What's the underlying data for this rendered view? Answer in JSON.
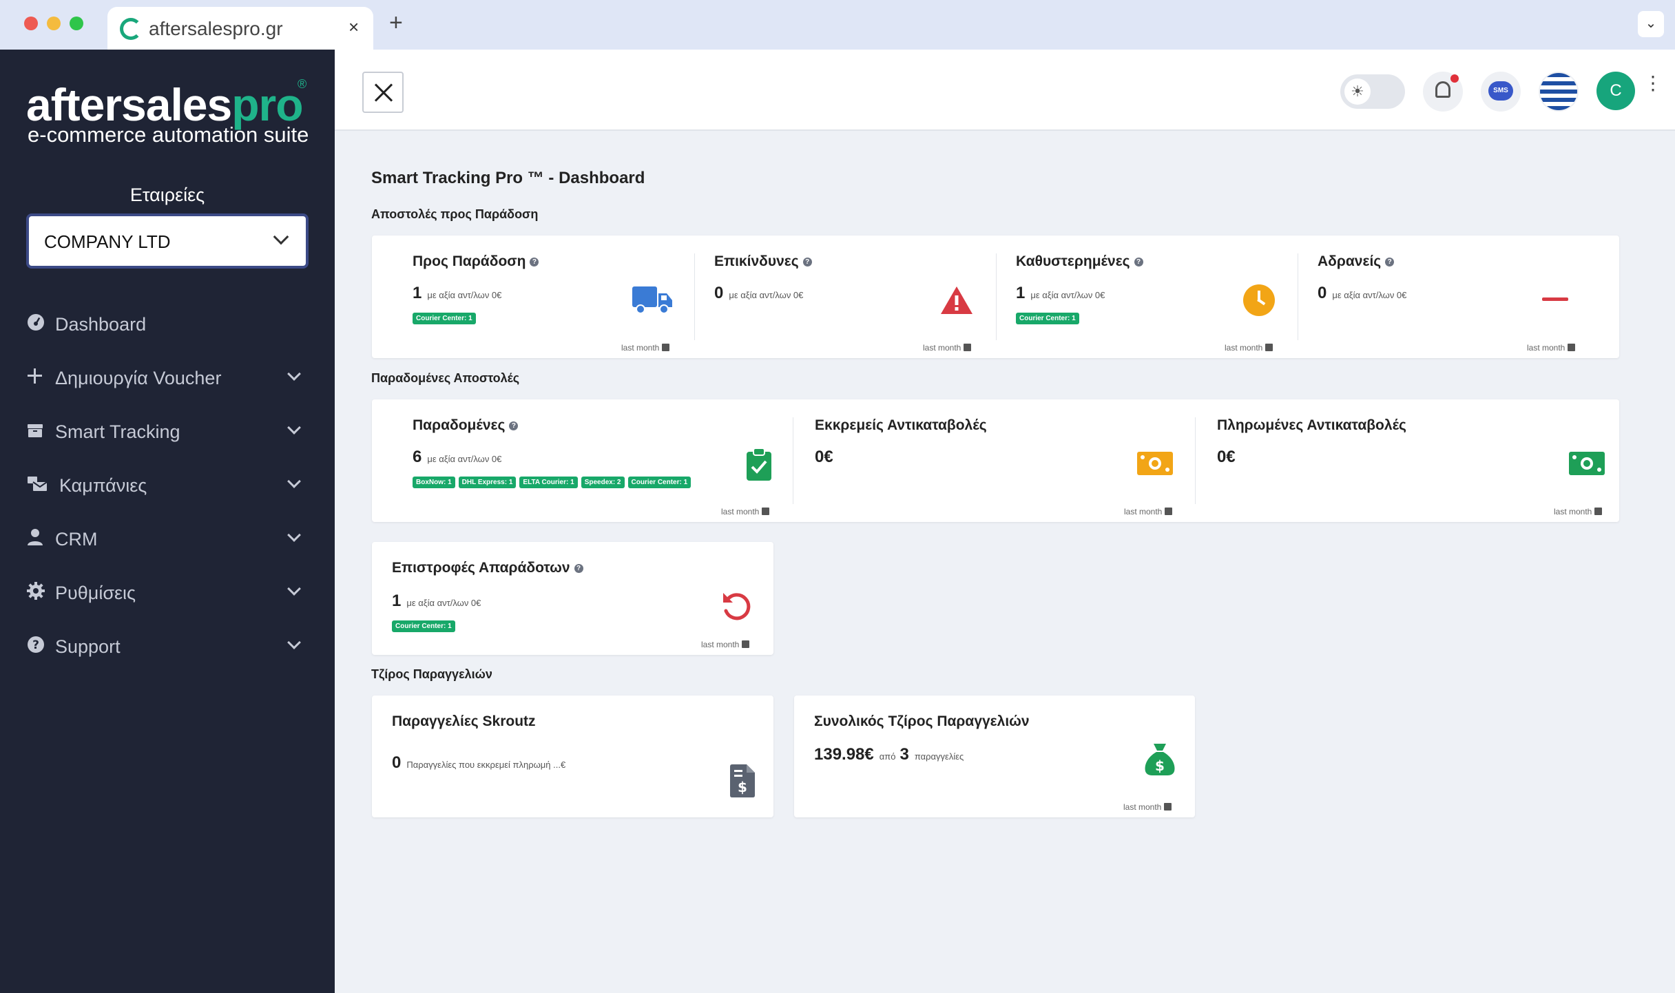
{
  "browser": {
    "tab_title": "aftersalespro.gr",
    "tab_close": "×",
    "new_tab": "+",
    "menu_glyph": "⌄"
  },
  "sidebar": {
    "logo_main": "aftersales",
    "logo_accent": "pro",
    "logo_reg": "®",
    "tagline": "e-commerce automation suite",
    "companies_label": "Εταιρείες",
    "company_selected": "COMPANY LTD",
    "items": [
      {
        "label": "Dashboard",
        "icon": "dashboard-icon"
      },
      {
        "label": "Δημιουργία Voucher",
        "icon": "plus-icon"
      },
      {
        "label": "Smart Tracking",
        "icon": "box-icon"
      },
      {
        "label": "Καμπάνιες",
        "icon": "mail-bulk-icon"
      },
      {
        "label": "CRM",
        "icon": "user-icon"
      },
      {
        "label": "Ρυθμίσεις",
        "icon": "gear-icon"
      },
      {
        "label": "Support",
        "icon": "question-circle-icon"
      }
    ]
  },
  "header": {
    "avatar_initial": "C",
    "sms_label": "SMS",
    "kebab": "⋮"
  },
  "main": {
    "page_title": "Smart Tracking Pro ™ - Dashboard",
    "last_month": "last month",
    "section_pending": "Αποστολές προς Παράδοση",
    "section_delivered": "Παραδομένες Αποστολές",
    "section_turnover": "Τζίρος Παραγγελιών",
    "pending_cards": [
      {
        "title": "Προς Παράδοση",
        "value": "1",
        "sub": "με αξία αντ/λων 0€",
        "tags": [
          "Courier Center: 1"
        ],
        "icon": "truck-icon",
        "color": "#3a7bd5"
      },
      {
        "title": "Επικίνδυνες",
        "value": "0",
        "sub": "με αξία αντ/λων 0€",
        "tags": [],
        "icon": "warning-icon",
        "color": "#d83a43"
      },
      {
        "title": "Καθυστερημένες",
        "value": "1",
        "sub": "με αξία αντ/λων 0€",
        "tags": [
          "Courier Center: 1"
        ],
        "icon": "clock-icon",
        "color": "#f2a516"
      },
      {
        "title": "Αδρανείς",
        "value": "0",
        "sub": "με αξία αντ/λων 0€",
        "tags": [],
        "icon": "minus-icon",
        "color": "#d83a43"
      }
    ],
    "delivered_cards": [
      {
        "title": "Παραδομένες",
        "value": "6",
        "sub": "με αξία αντ/λων 0€",
        "tags": [
          "BoxNow: 1",
          "DHL Express: 1",
          "ELTA Courier: 1",
          "Speedex: 2",
          "Courier Center: 1"
        ],
        "icon": "clipboard-check-icon",
        "color": "#1e9f57"
      },
      {
        "title": "Εκκρεμείς Αντικαταβολές",
        "value": "0€",
        "sub": "",
        "tags": [],
        "icon": "money-bill-icon",
        "color": "#f2a516"
      },
      {
        "title": "Πληρωμένες Αντικαταβολές",
        "value": "0€",
        "sub": "",
        "tags": [],
        "icon": "money-bill-icon",
        "color": "#1e9f57"
      }
    ],
    "returns_card": {
      "title": "Επιστροφές Απαράδοτων",
      "value": "1",
      "sub": "με αξία αντ/λων 0€",
      "tags": [
        "Courier Center: 1"
      ],
      "icon": "undo-icon",
      "color": "#d83a43"
    },
    "skroutz_card": {
      "title": "Παραγγελίες Skroutz",
      "value": "0",
      "sub": "Παραγγελίες που εκκρεμεί πληρωμή ...€",
      "icon": "invoice-dollar-icon",
      "color": "#5a6270"
    },
    "turnover_card": {
      "title": "Συνολικός Τζίρος Παραγγελιών",
      "value": "139.98€",
      "sub_from": "από",
      "orders": "3",
      "sub_orders": "παραγγελίες",
      "icon": "money-bag-icon",
      "color": "#1e9f57"
    }
  }
}
